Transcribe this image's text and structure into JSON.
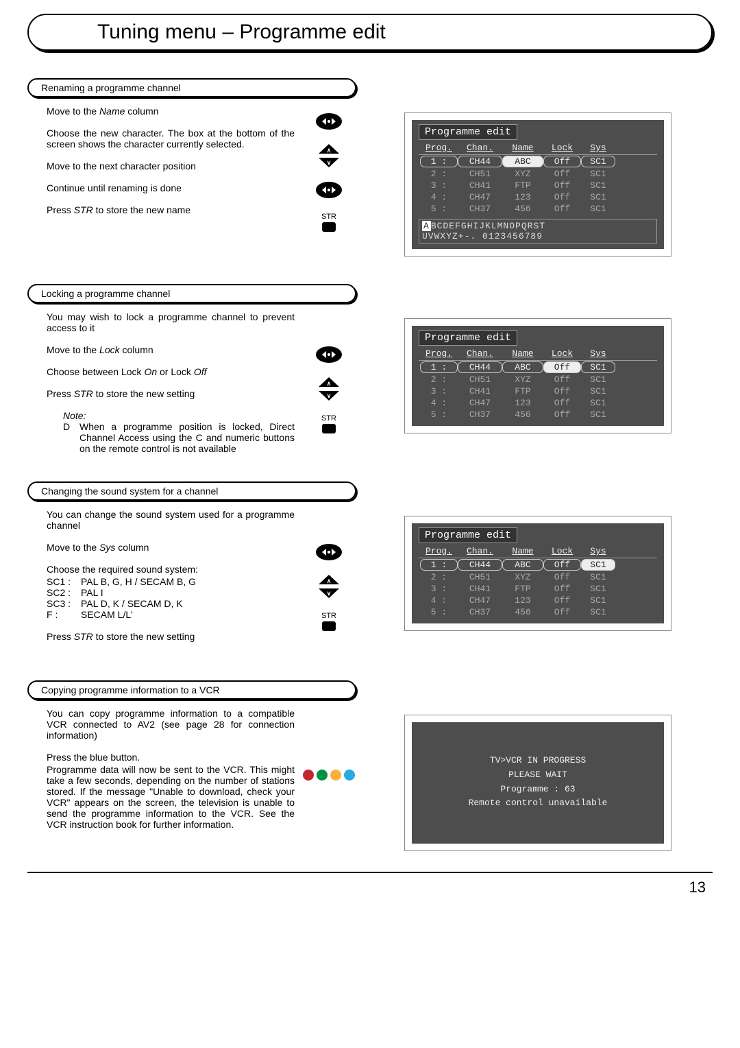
{
  "page_title": "Tuning menu – Programme edit",
  "page_number": "13",
  "section1": {
    "header": "Renaming a programme channel",
    "l1_a": "Move to the ",
    "l1_b": "Name",
    "l1_c": " column",
    "l2": "Choose the new character. The box at the bottom of the screen shows the character currently selected.",
    "l3": "Move to the next character position",
    "l4": "Continue until renaming is done",
    "l5_a": "Press ",
    "l5_b": "STR",
    "l5_c": " to store the new name",
    "str_label": "STR"
  },
  "section2": {
    "header": "Locking a programme channel",
    "l1": "You may wish to lock a programme channel to prevent access to it",
    "l2_a": "Move to the ",
    "l2_b": "Lock",
    "l2_c": " column",
    "l3_a": "Choose between Lock ",
    "l3_b": "On",
    "l3_c": " or Lock ",
    "l3_d": "Off",
    "l4_a": "Press ",
    "l4_b": "STR",
    "l4_c": " to store the new setting",
    "note_label": "Note:",
    "note_bullet": "D",
    "note_text_a": "When a programme position is locked, Direct Channel Access using the ",
    "note_text_b": "C",
    "note_text_c": " and numeric buttons on the remote control is not available",
    "str_label": "STR"
  },
  "section3": {
    "header": "Changing the sound system for a channel",
    "l1": "You can change the sound system used for a programme channel",
    "l2_a": "Move to the ",
    "l2_b": "Sys",
    "l2_c": " column",
    "l3": "Choose the required sound system:",
    "sys": [
      {
        "l": "SC1 :",
        "r": "PAL B, G, H / SECAM B, G"
      },
      {
        "l": "SC2 :",
        "r": "PAL I"
      },
      {
        "l": "SC3 :",
        "r": "PAL D, K / SECAM D, K"
      },
      {
        "l": "F      :",
        "r": "SECAM L/L'"
      }
    ],
    "l4_a": "Press ",
    "l4_b": "STR",
    "l4_c": " to store the new setting",
    "str_label": "STR"
  },
  "section4": {
    "header": "Copying programme information to a VCR",
    "l1": "You can copy programme information to a compatible VCR connected to AV2 (see page 28 for connection information)",
    "l2": "Press the blue button.",
    "l3": "Programme data will now be sent to the VCR. This might take a few seconds, depending on the number of stations stored. If the message \"Unable to download, check your VCR\" appears on the screen, the television is unable to send the programme information to the VCR. See the VCR instruction book for further information."
  },
  "osd_common": {
    "title": "Programme edit",
    "head": {
      "prog": "Prog.",
      "chan": "Chan.",
      "name": "Name",
      "lock": "Lock",
      "sys": "Sys"
    },
    "rows": [
      {
        "prog": "1 :",
        "chan": "CH44",
        "name": "ABC",
        "lock": "Off",
        "sys": "SC1"
      },
      {
        "prog": "2 :",
        "chan": "CH51",
        "name": "XYZ",
        "lock": "Off",
        "sys": "SC1"
      },
      {
        "prog": "3 :",
        "chan": "CH41",
        "name": "FTP",
        "lock": "Off",
        "sys": "SC1"
      },
      {
        "prog": "4 :",
        "chan": "CH47",
        "name": "123",
        "lock": "Off",
        "sys": "SC1"
      },
      {
        "prog": "5 :",
        "chan": "CH37",
        "name": "456",
        "lock": "Off",
        "sys": "SC1"
      }
    ],
    "charstrip_cursor": "A",
    "charstrip_l1_rest": "BCDEFGHIJKLMNOPQRST",
    "charstrip_l2": "UVWXYZ+-. 0123456789"
  },
  "osd_vcr": {
    "l1": "TV>VCR IN PROGRESS",
    "l2": "PLEASE WAIT",
    "l3": "Programme : 63",
    "l4": "Remote control unavailable"
  }
}
